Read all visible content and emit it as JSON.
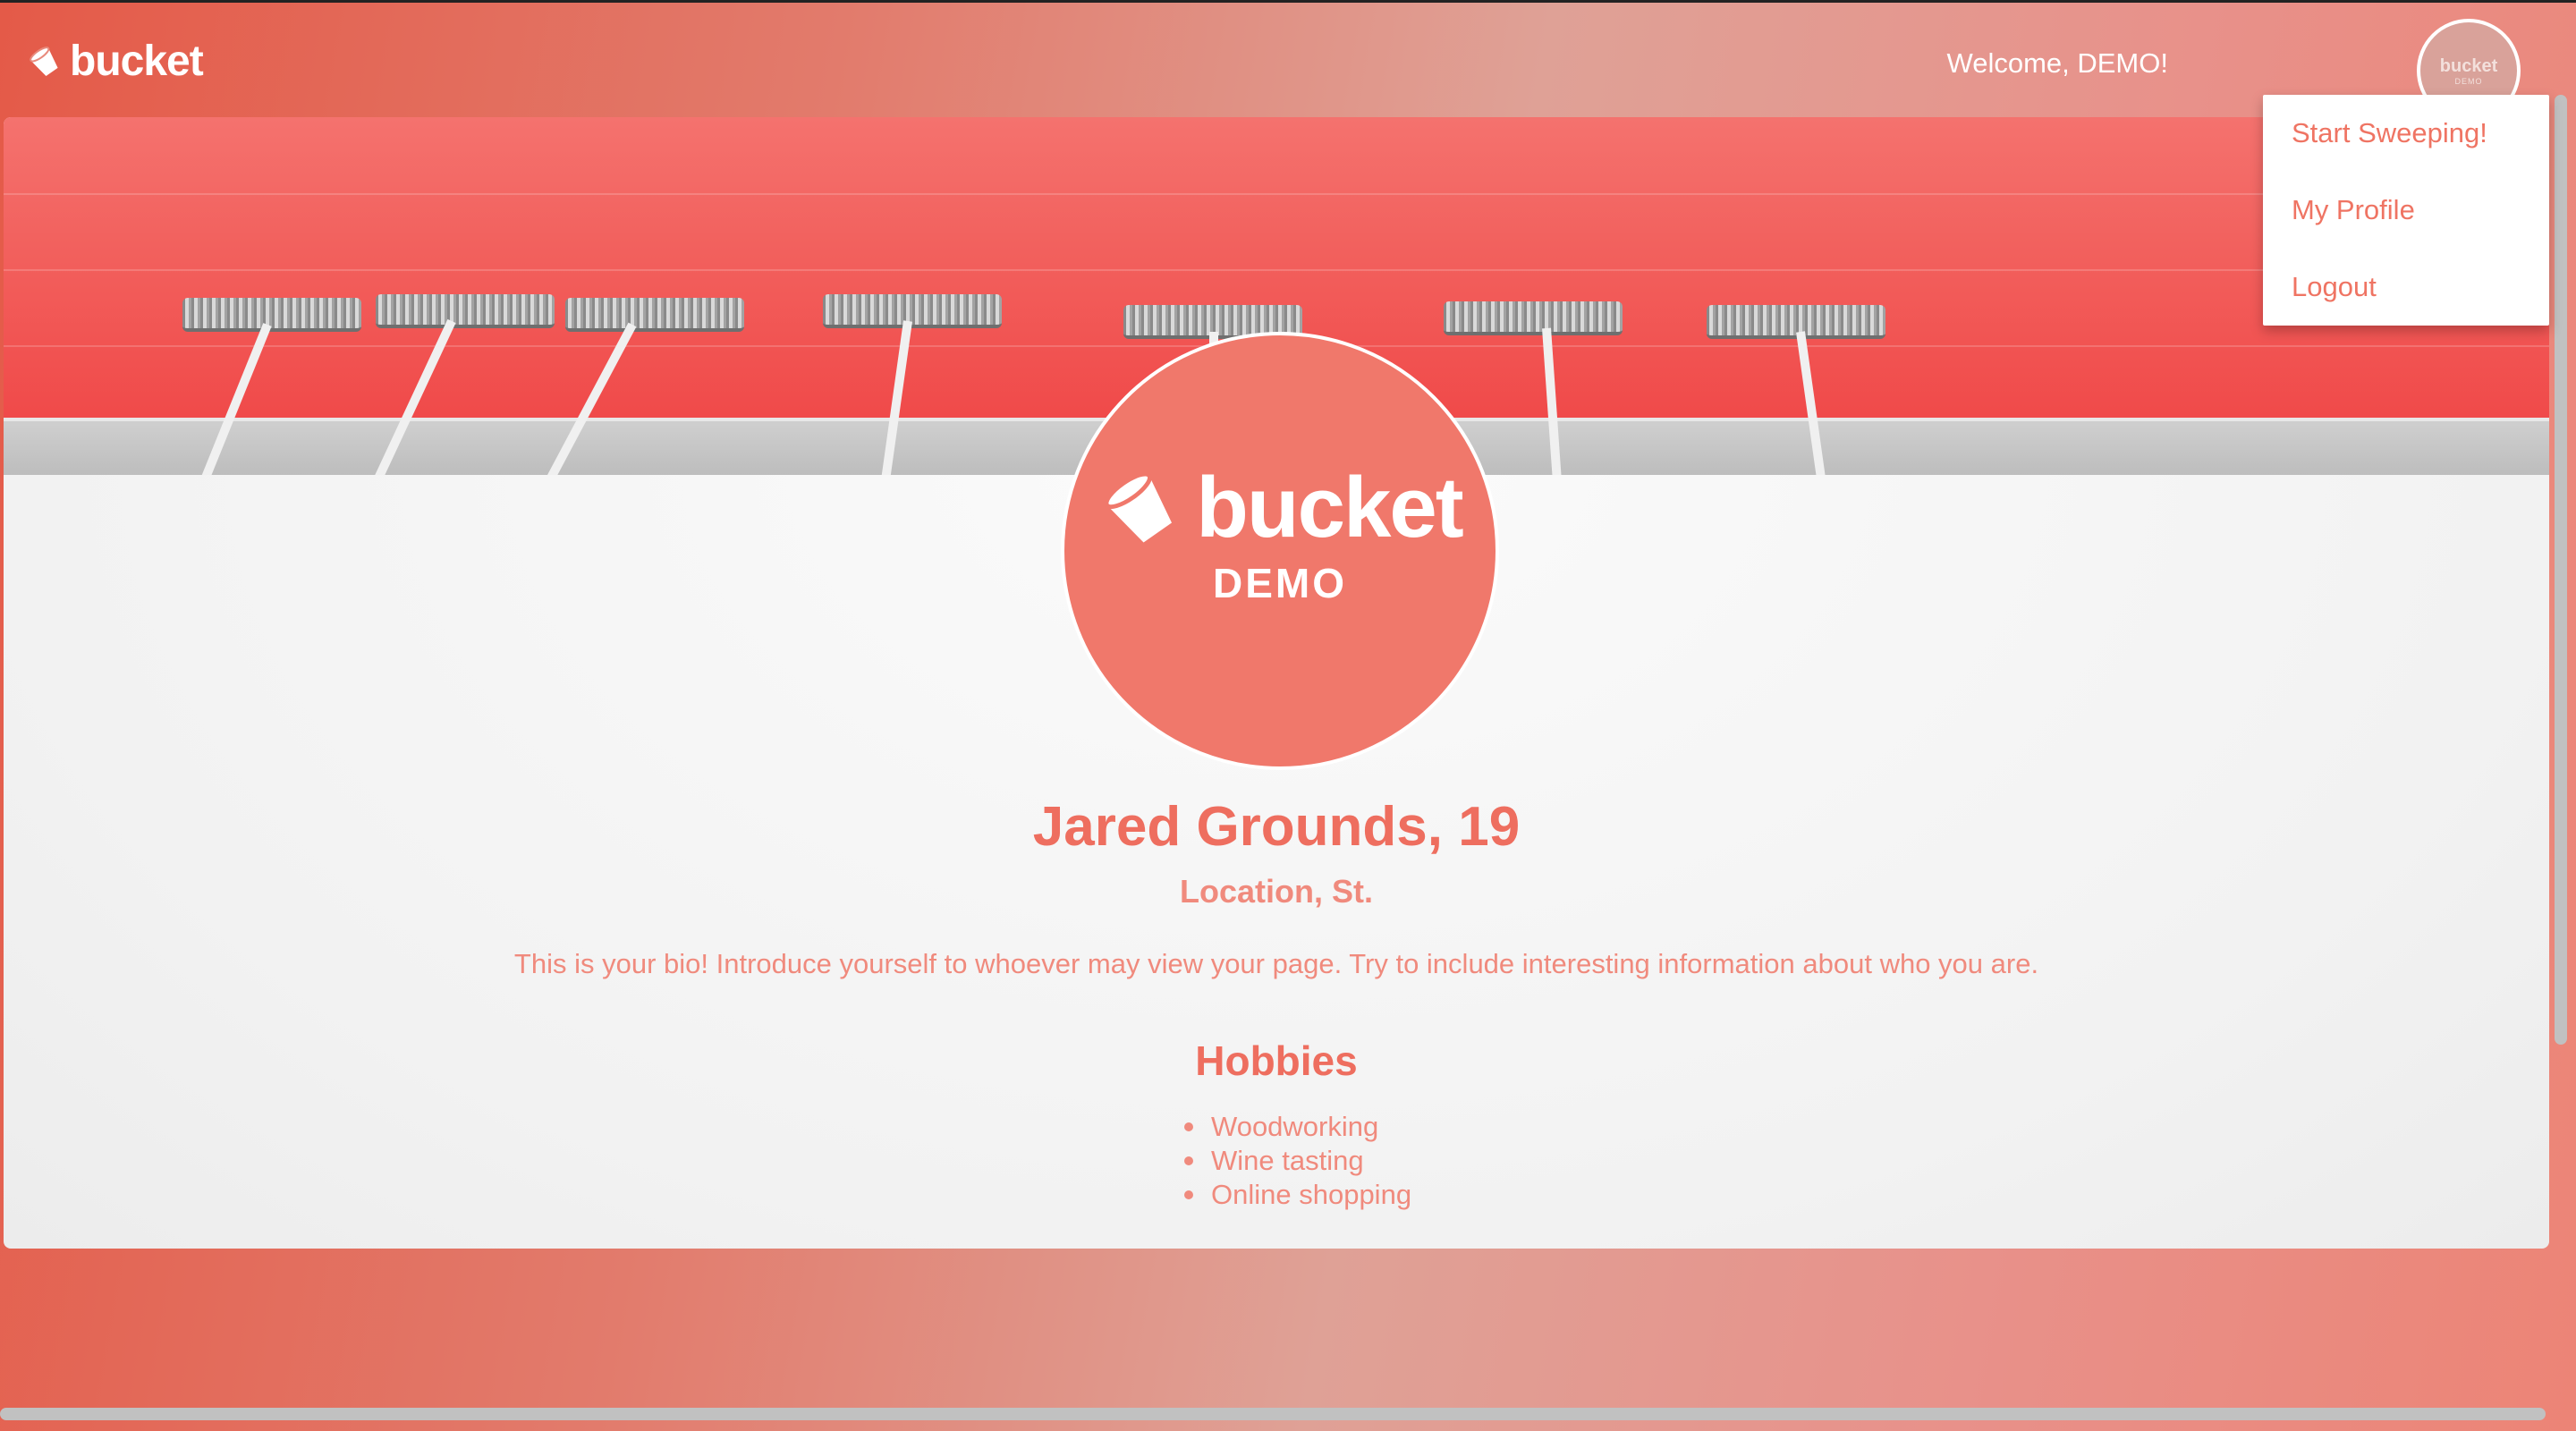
{
  "navbar": {
    "brand": "bucket",
    "welcome": "Welcome, DEMO!",
    "avatar": {
      "word": "bucket",
      "sub": "DEMO"
    }
  },
  "dropdown": {
    "items": [
      {
        "label": "Start Sweeping!"
      },
      {
        "label": "My Profile"
      },
      {
        "label": "Logout"
      }
    ]
  },
  "profile": {
    "logo_word": "bucket",
    "logo_sub": "DEMO",
    "name": "Jared Grounds, 19",
    "location": "Location, St.",
    "bio": "This is your bio! Introduce yourself to whoever may view your page. Try to include interesting information about who you are.",
    "hobbies_title": "Hobbies",
    "hobbies": [
      "Woodworking",
      "Wine tasting",
      "Online shopping"
    ]
  },
  "colors": {
    "accent": "#ee6e5f",
    "accent_light": "#f08a7d",
    "banner_red": "#f04747"
  }
}
